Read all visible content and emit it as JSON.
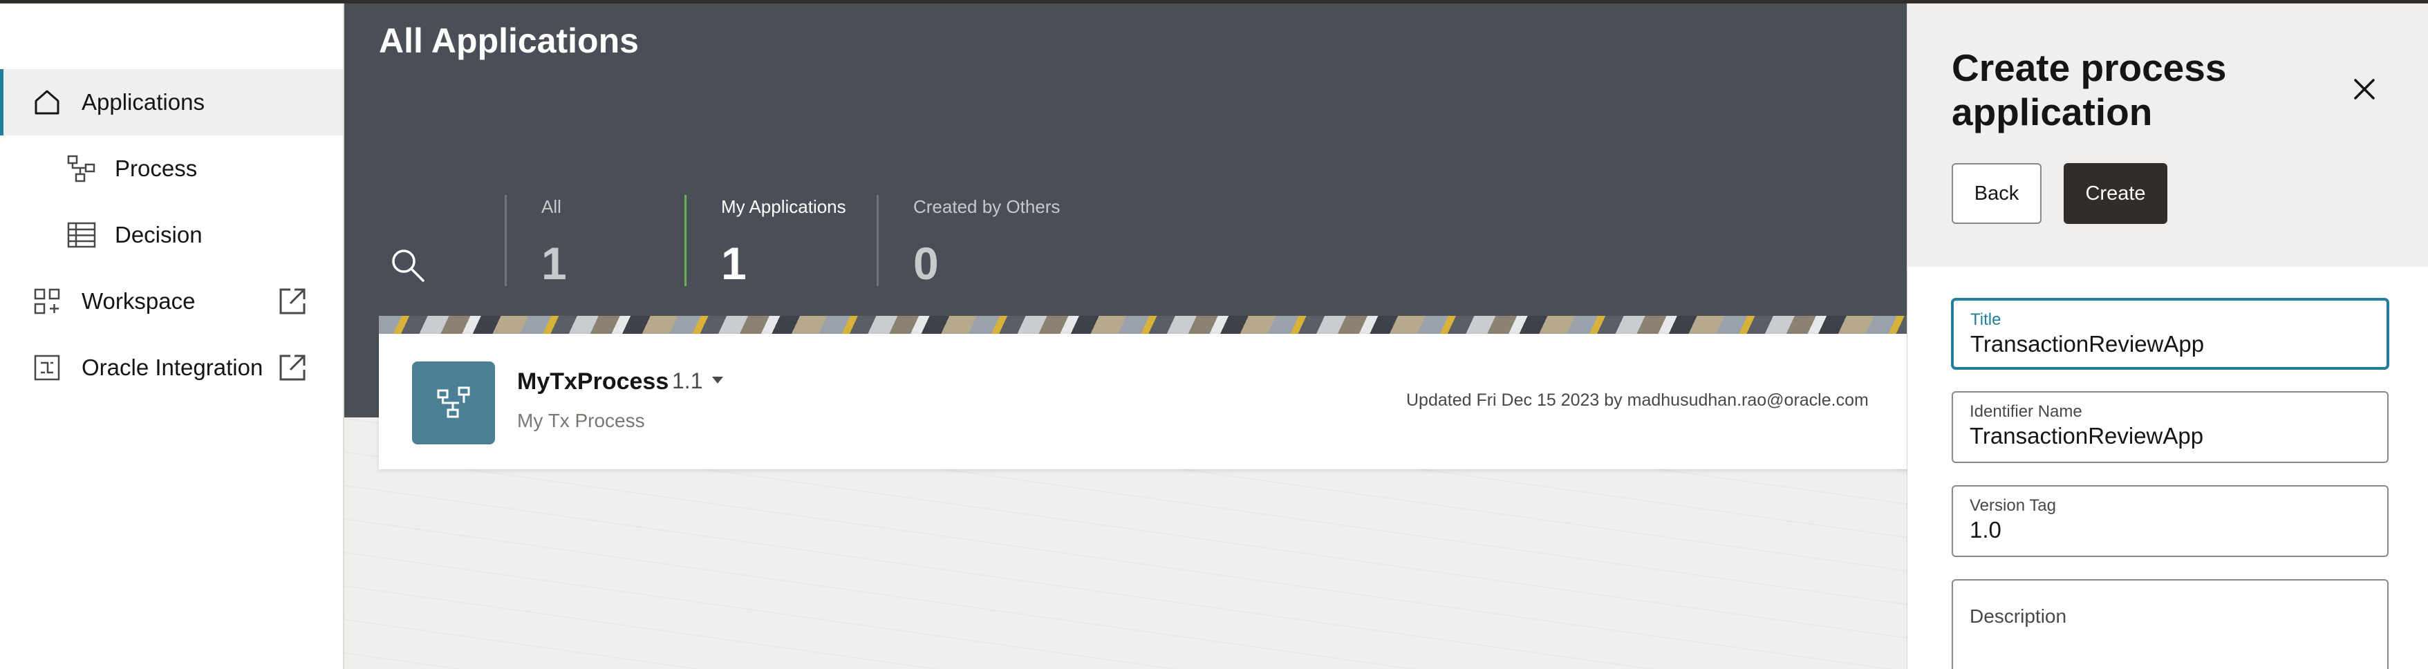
{
  "sidebar": {
    "items": [
      {
        "label": "Applications",
        "icon": "home-icon",
        "active": true
      },
      {
        "label": "Process",
        "icon": "process-icon"
      },
      {
        "label": "Decision",
        "icon": "table-icon"
      },
      {
        "label": "Workspace",
        "icon": "workspace-icon",
        "external": true
      },
      {
        "label": "Oracle Integration",
        "icon": "integration-icon",
        "external": true
      }
    ]
  },
  "main": {
    "title": "All Applications",
    "filters": [
      {
        "label": "All",
        "count": "1"
      },
      {
        "label": "My Applications",
        "count": "1",
        "selected": true
      },
      {
        "label": "Created by Others",
        "count": "0"
      }
    ],
    "app": {
      "name": "MyTxProcess",
      "version": "1.1",
      "description": "My Tx Process",
      "updated": "Updated Fri Dec 15 2023 by madhusudhan.rao@oracle.com"
    }
  },
  "drawer": {
    "title": "Create process application",
    "back_label": "Back",
    "create_label": "Create",
    "fields": {
      "title": {
        "label": "Title",
        "value": "TransactionReviewApp"
      },
      "identifier": {
        "label": "Identifier Name",
        "value": "TransactionReviewApp"
      },
      "version": {
        "label": "Version Tag",
        "value": "1.0"
      },
      "description": {
        "label": "Description",
        "value": ""
      }
    }
  },
  "colors": {
    "accent": "#227e9e",
    "header": "#4a4e56",
    "selected_filter": "#6aaf5a",
    "app_tile": "#4a7f95",
    "primary_button": "#312d2a"
  }
}
